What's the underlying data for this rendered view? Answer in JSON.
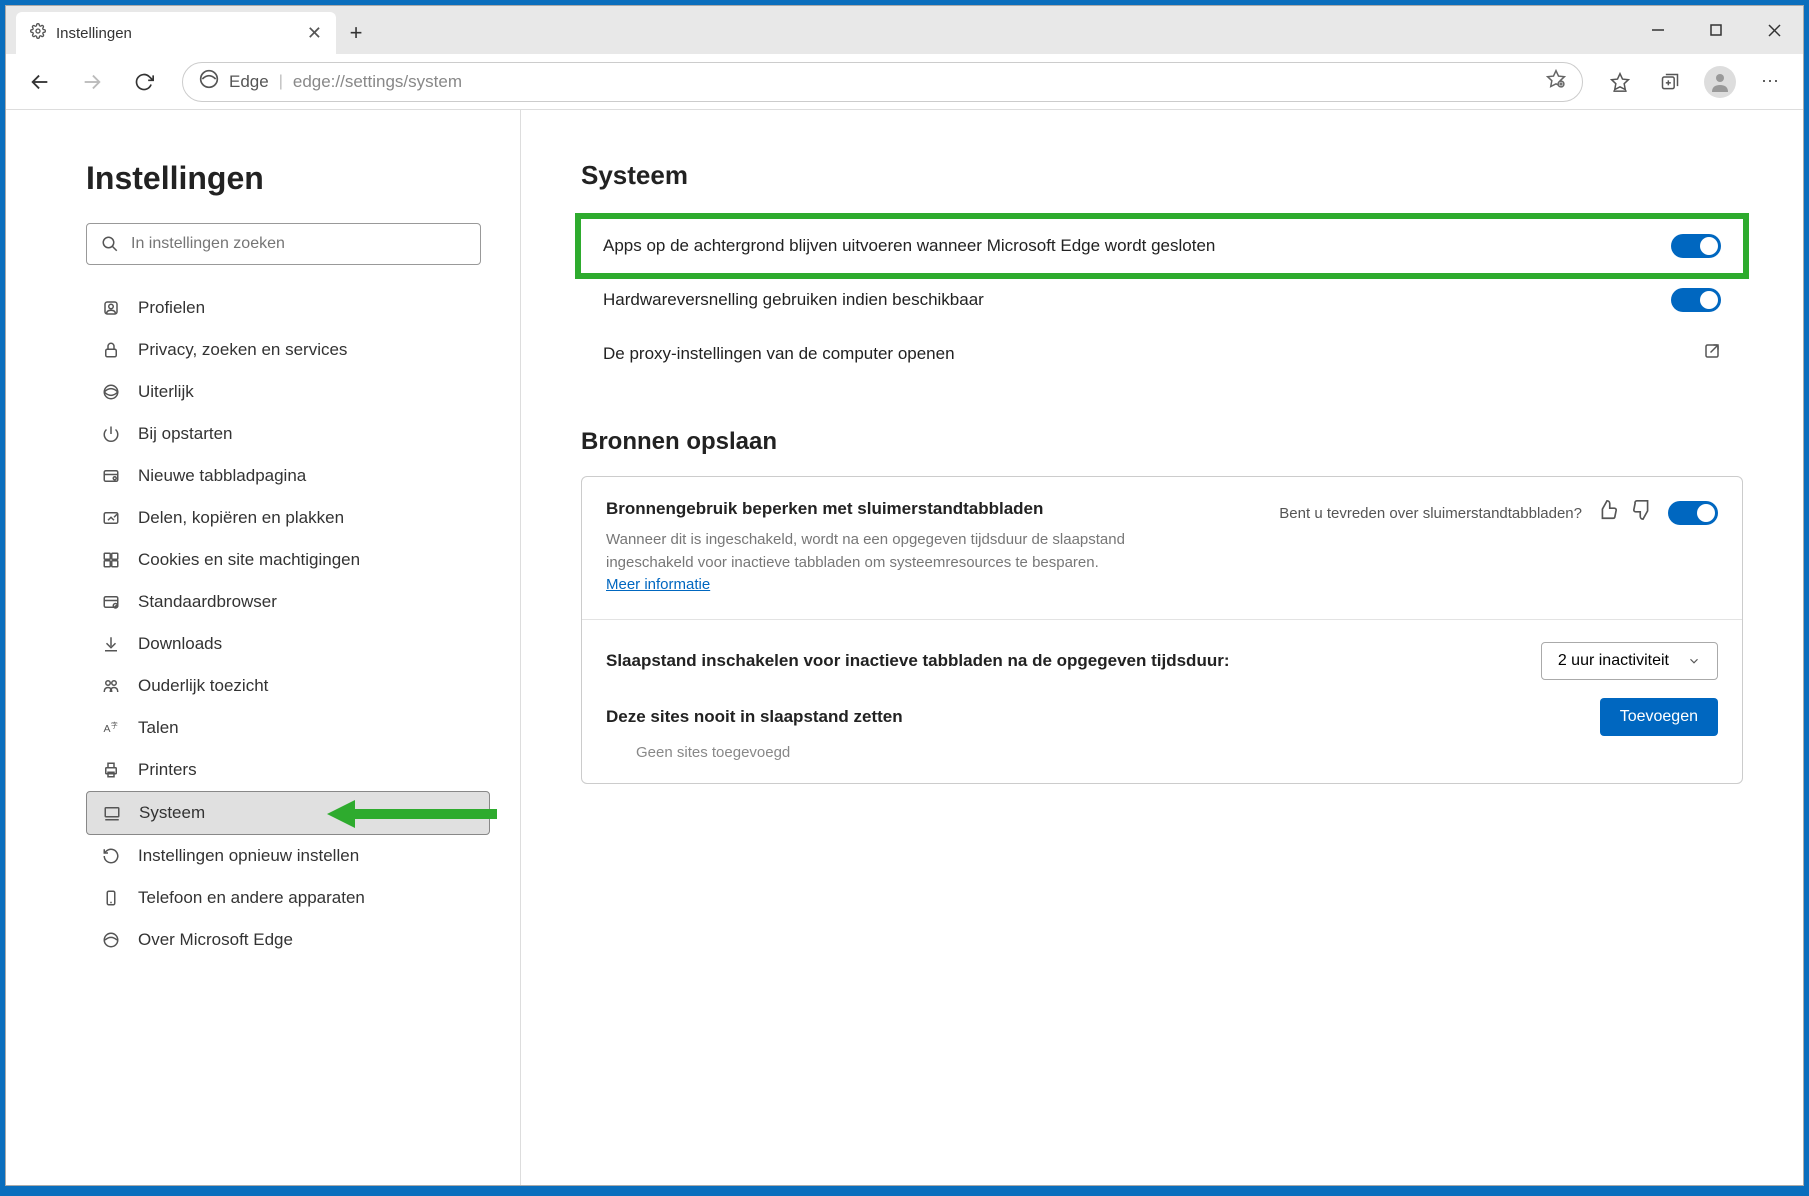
{
  "tab_title": "Instellingen",
  "url_site": "Edge",
  "url_path": "edge://settings/system",
  "sidebar": {
    "title": "Instellingen",
    "search_placeholder": "In instellingen zoeken",
    "items": [
      {
        "label": "Profielen"
      },
      {
        "label": "Privacy, zoeken en services"
      },
      {
        "label": "Uiterlijk"
      },
      {
        "label": "Bij opstarten"
      },
      {
        "label": "Nieuwe tabbladpagina"
      },
      {
        "label": "Delen, kopiëren en plakken"
      },
      {
        "label": "Cookies en site machtigingen"
      },
      {
        "label": "Standaardbrowser"
      },
      {
        "label": "Downloads"
      },
      {
        "label": "Ouderlijk toezicht"
      },
      {
        "label": "Talen"
      },
      {
        "label": "Printers"
      },
      {
        "label": "Systeem"
      },
      {
        "label": "Instellingen opnieuw instellen"
      },
      {
        "label": "Telefoon en andere apparaten"
      },
      {
        "label": "Over Microsoft Edge"
      }
    ]
  },
  "main": {
    "heading": "Systeem",
    "row_background": "Apps op de achtergrond blijven uitvoeren wanneer Microsoft Edge wordt gesloten",
    "row_hardware": "Hardwareversnelling gebruiken indien beschikbaar",
    "row_proxy": "De proxy-instellingen van de computer openen",
    "heading_resources": "Bronnen opslaan",
    "card": {
      "title": "Bronnengebruik beperken met sluimerstandtabbladen",
      "desc": "Wanneer dit is ingeschakeld, wordt na een opgegeven tijdsduur de slaapstand ingeschakeld voor inactieve tabbladen om systeemresources te besparen. ",
      "learn_more": "Meer informatie",
      "feedback_prompt": "Bent u tevreden over sluimerstandtabbladen?",
      "sleep_after": "Slaapstand inschakelen voor inactieve tabbladen na de opgegeven tijdsduur:",
      "sleep_value": "2 uur inactiviteit",
      "never_sleep": "Deze sites nooit in slaapstand zetten",
      "add_button": "Toevoegen",
      "no_sites": "Geen sites toegevoegd"
    }
  }
}
